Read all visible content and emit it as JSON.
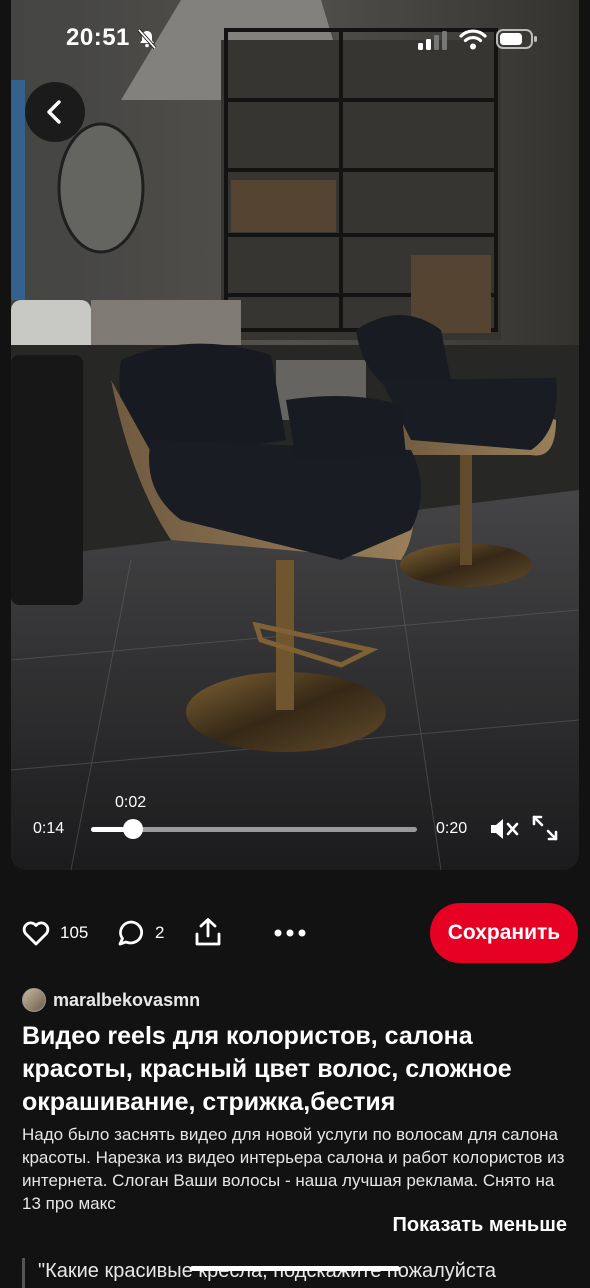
{
  "status_bar": {
    "time": "20:51"
  },
  "video": {
    "elapsed": "0:14",
    "position_bubble": "0:02",
    "duration": "0:20",
    "progress_fraction": 0.13
  },
  "actions": {
    "like_count": "105",
    "comment_count": "2",
    "save_label": "Сохранить"
  },
  "pin": {
    "author": "maralbekovasmn",
    "title": "Видео reels для колористов, салона красоты, красный цвет волос, сложное окрашивание, стрижка,бестия",
    "description": "Надо было заснять видео для новой услуги по волосам для салона красоты. Нарезка из видео интерьера салона и работ колористов из интернета. Слоган Ваши волосы - наша лучшая реклама. Снято на 13 про макс",
    "show_less_label": "Показать меньше"
  },
  "comment_preview": "\"Какие красивые кресла, подскажите пожалуйста"
}
